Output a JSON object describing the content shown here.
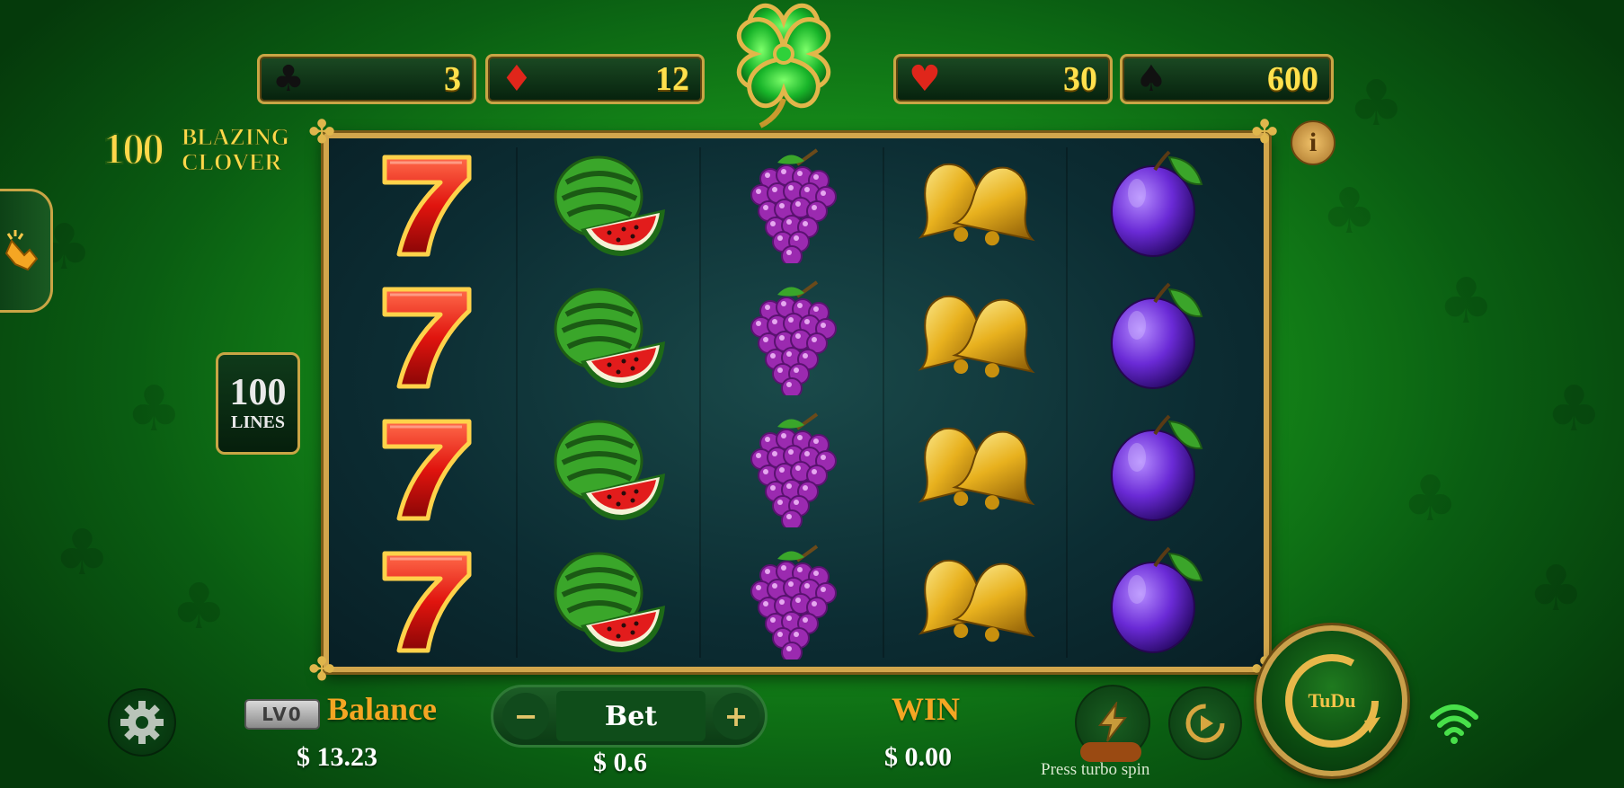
{
  "game": {
    "logo_number": "100",
    "logo_line1": "BLAZING",
    "logo_line2": "CLOVER",
    "lines_number": "100",
    "lines_label": "LINES"
  },
  "jackpots": [
    {
      "suit": "club-icon",
      "glyph": "♣",
      "value": "3",
      "color": "#111111"
    },
    {
      "suit": "diamond-icon",
      "glyph": "♦",
      "value": "12",
      "color": "#e0261b"
    },
    {
      "suit": "heart-icon",
      "glyph": "♥",
      "value": "30",
      "color": "#e0261b"
    },
    {
      "suit": "spade-icon",
      "glyph": "♠",
      "value": "600",
      "color": "#111111"
    }
  ],
  "reels": [
    [
      "seven",
      "seven",
      "seven",
      "seven"
    ],
    [
      "watermelon",
      "watermelon",
      "watermelon",
      "watermelon"
    ],
    [
      "grapes",
      "grapes",
      "grapes",
      "grapes"
    ],
    [
      "bells",
      "bells",
      "bells",
      "bells"
    ],
    [
      "plum",
      "plum",
      "plum",
      "plum"
    ]
  ],
  "hud": {
    "level_badge": "LV0",
    "balance_label": "Balance",
    "balance_value": "$ 13.23",
    "bet_minus": "−",
    "bet_label": "Bet",
    "bet_plus": "+",
    "bet_value": "$ 0.6",
    "win_label": "WIN",
    "win_value": "$ 0.00",
    "turbo_hint": "Press turbo spin",
    "spin_label": "TuDu",
    "info_label": "i"
  },
  "colors": {
    "gold": "#d2a64c",
    "accent_orange": "#f5a623",
    "jackpot_value": "#ffe14d",
    "wifi": "#48e04a"
  }
}
